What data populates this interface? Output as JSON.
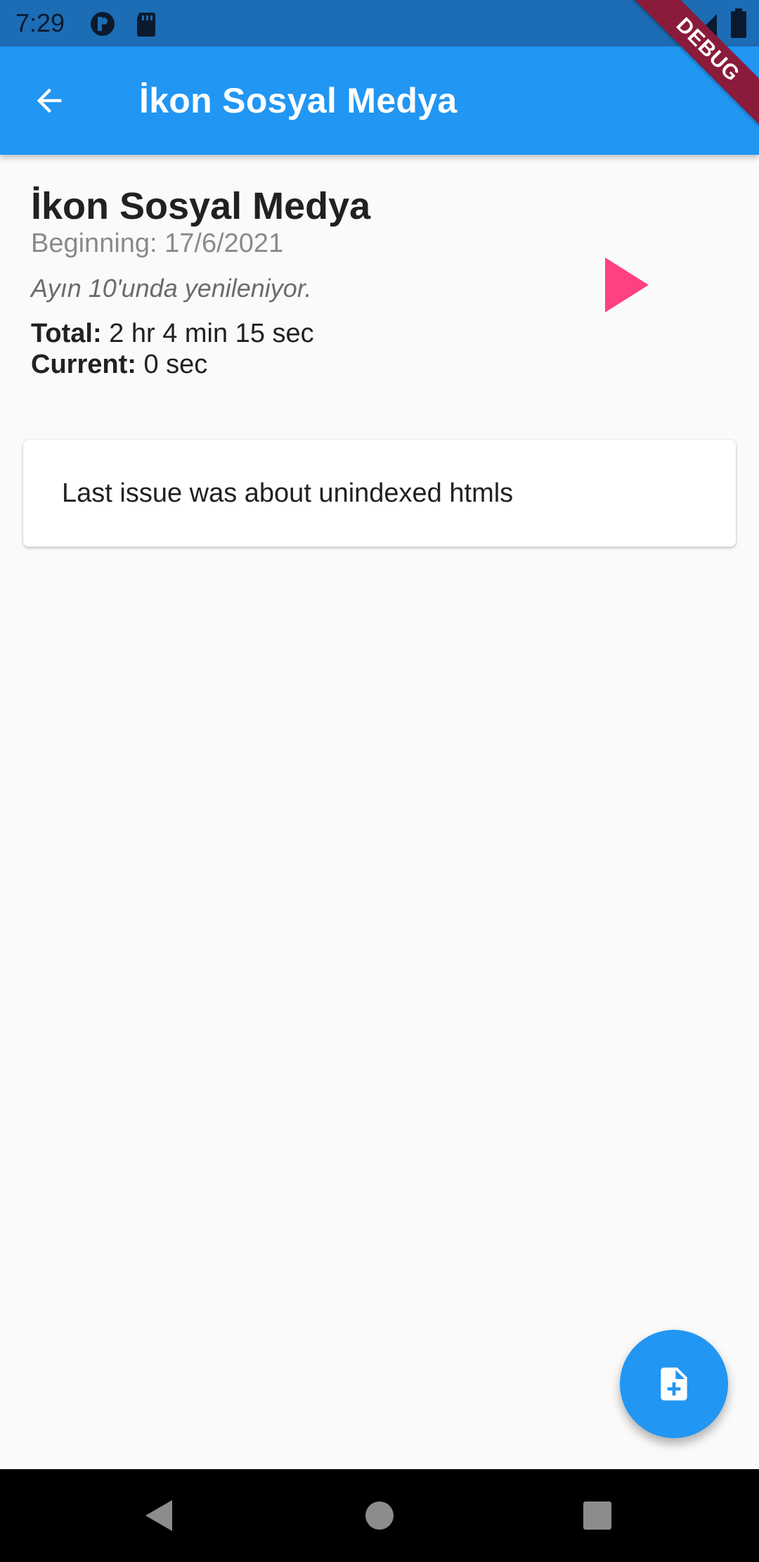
{
  "status_bar": {
    "time": "7:29",
    "icons": [
      "media-icon",
      "sd-card-icon",
      "wifi-icon",
      "signal-icon",
      "battery-icon"
    ]
  },
  "debug_banner": {
    "label": "DEBUG"
  },
  "app_bar": {
    "title": "İkon Sosyal Medya",
    "back_icon": "arrow-back-icon",
    "background": "#2196f3"
  },
  "entry": {
    "title": "İkon Sosyal Medya",
    "beginning": "Beginning: 17/6/2021",
    "note": "Ayın 10'unda yenileniyor.",
    "total_label": "Total:",
    "total_value": " 2 hr 4 min 15 sec",
    "current_label": "Current:",
    "current_value": " 0 sec",
    "play_icon": "play-icon",
    "play_color": "#ff4081"
  },
  "issue": {
    "text": "Last issue was about unindexed htmls"
  },
  "fab": {
    "icon": "note-add-icon",
    "color": "#2196f3"
  },
  "nav_bar": {
    "buttons": [
      "nav-back-icon",
      "nav-home-icon",
      "nav-recents-icon"
    ]
  }
}
